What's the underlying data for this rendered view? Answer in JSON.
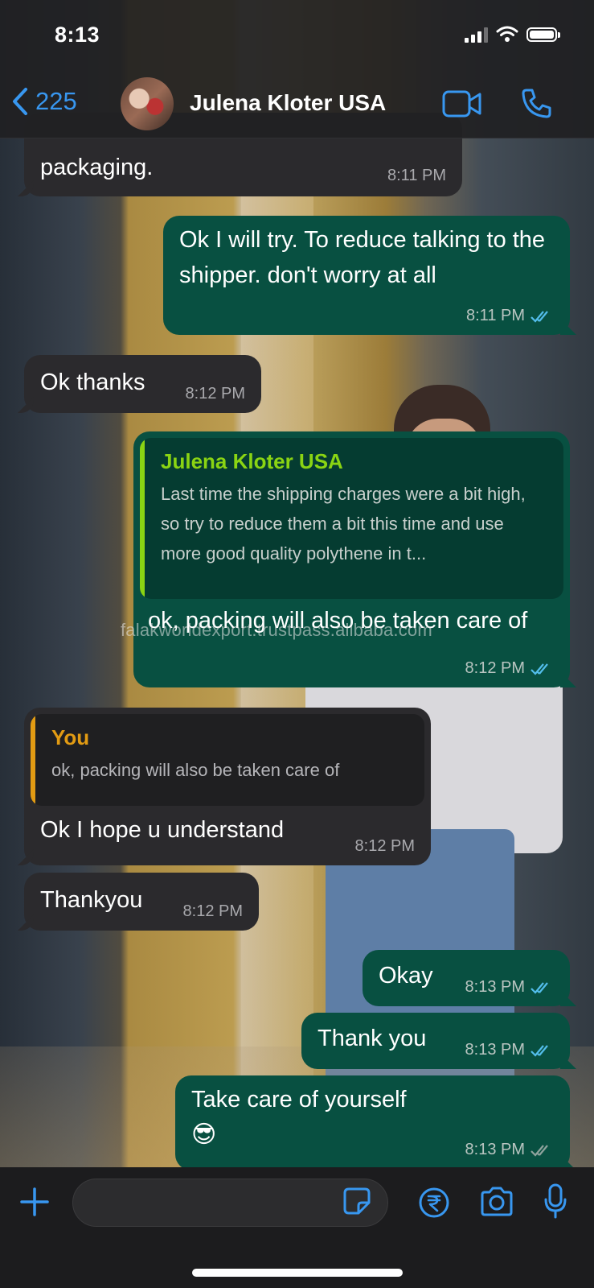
{
  "status_bar": {
    "time": "8:13"
  },
  "header": {
    "back_count": "225",
    "contact_name": "Julena Kloter USA"
  },
  "messages": [
    {
      "direction": "in",
      "text": "packaging.",
      "time": "8:11 PM"
    },
    {
      "direction": "out",
      "text": "Ok I will try. To reduce talking to the shipper. don't worry at all",
      "time": "8:11 PM",
      "read": true
    },
    {
      "direction": "in",
      "text": "Ok thanks",
      "time": "8:12 PM"
    },
    {
      "direction": "out",
      "quote": {
        "author": "Julena Kloter USA",
        "text": "Last time the shipping charges were a bit high, so try to reduce them a bit this time and use more good quality polythene in t..."
      },
      "text": "ok, packing will also be taken care of",
      "time": "8:12 PM",
      "read": true
    },
    {
      "direction": "in",
      "quote": {
        "author": "You",
        "text": "ok, packing will also be taken care of"
      },
      "text": "Ok I hope u understand",
      "time": "8:12 PM"
    },
    {
      "direction": "in",
      "text": "Thankyou",
      "time": "8:12 PM"
    },
    {
      "direction": "out",
      "text": "Okay",
      "time": "8:13 PM",
      "read": true
    },
    {
      "direction": "out",
      "text": "Thank you",
      "time": "8:13 PM",
      "read": true
    },
    {
      "direction": "out",
      "text": "Take care of yourself",
      "emoji": "😎",
      "time": "8:13 PM",
      "read": false
    }
  ],
  "watermark": "falakworldexport.trustpass.alibaba.com",
  "colors": {
    "outgoing_bubble": "#085041",
    "incoming_bubble": "#2b2a2d",
    "accent_blue": "#3897f0",
    "quote_green": "#8ad413",
    "quote_orange": "#e29b13"
  },
  "icons": {
    "header": [
      "chevron-left-icon",
      "video-camera-icon",
      "phone-icon"
    ],
    "input": [
      "plus-icon",
      "sticker-icon",
      "rupee-icon",
      "camera-icon",
      "microphone-icon"
    ]
  }
}
